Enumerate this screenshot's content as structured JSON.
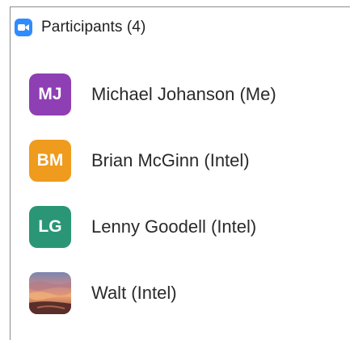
{
  "header": {
    "title": "Participants (4)",
    "icon": "zoom-camera-icon",
    "icon_color": "#2d8cff"
  },
  "participants": [
    {
      "initials": "MJ",
      "name": "Michael Johanson (Me)",
      "avatar_color": "#8e3fb3"
    },
    {
      "initials": "BM",
      "name": "Brian McGinn (Intel)",
      "avatar_color": "#ef9b1d"
    },
    {
      "initials": "LG",
      "name": "Lenny Goodell (Intel)",
      "avatar_color": "#2a9675"
    },
    {
      "initials": "",
      "name": "Walt (Intel)",
      "avatar_type": "photo-sunset"
    }
  ]
}
